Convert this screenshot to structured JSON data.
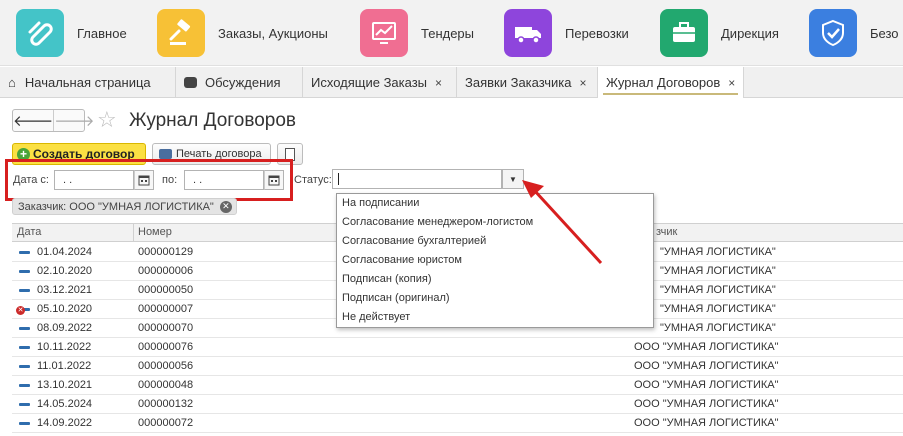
{
  "sections": [
    {
      "label": "Главное",
      "icon": "main-section-icon",
      "color": "#44c4c8"
    },
    {
      "label": "Заказы, Аукционы",
      "icon": "auction-gavel-icon",
      "color": "#f7c136"
    },
    {
      "label": "Тендеры",
      "icon": "chart-icon",
      "color": "#f06e92"
    },
    {
      "label": "Перевозки",
      "icon": "truck-icon",
      "color": "#8e45dc"
    },
    {
      "label": "Дирекция",
      "icon": "briefcase-icon",
      "color": "#22a86f"
    },
    {
      "label": "Безо",
      "icon": "shield-check-icon",
      "color": "#3b7fe0"
    }
  ],
  "tabs": [
    {
      "label": "Начальная страница",
      "icon": "home-icon"
    },
    {
      "label": "Обсуждения",
      "icon": "discussions-icon"
    },
    {
      "label": "Исходящие Заказы",
      "close": "×"
    },
    {
      "label": "Заявки Заказчика",
      "close": "×"
    },
    {
      "label": "Журнал Договоров",
      "close": "×",
      "active": true
    }
  ],
  "form": {
    "title": "Журнал Договоров",
    "back_glyph": "🡐",
    "forward_glyph": "🡒",
    "star_glyph": "☆"
  },
  "toolbar": {
    "create_label": "Создать договор",
    "print_label": "Печать договора"
  },
  "filters": {
    "date_from_label": "Дата с:",
    "date_from_value": " .  .",
    "date_to_label": "по:",
    "date_to_value": " .  .",
    "status_label": "Статус:",
    "status_value": ""
  },
  "chip": {
    "label": "Заказчик: ООО \"УМНАЯ ЛОГИСТИКА\""
  },
  "status_options": [
    "На подписании",
    "Согласование менеджером-логистом",
    "Согласование бухгалтерией",
    "Согласование юристом",
    "Подписан (копия)",
    "Подписан (оригинал)",
    "Не действует"
  ],
  "table": {
    "columns": [
      "Дата",
      "Номер",
      "зчик"
    ],
    "rows": [
      {
        "date": "01.04.2024",
        "number": "000000129",
        "customer": "\"УМНАЯ ЛОГИСТИКА\"",
        "marked": false
      },
      {
        "date": "02.10.2020",
        "number": "000000006",
        "customer": "\"УМНАЯ ЛОГИСТИКА\"",
        "marked": false
      },
      {
        "date": "03.12.2021",
        "number": "000000050",
        "customer": "\"УМНАЯ ЛОГИСТИКА\"",
        "marked": false
      },
      {
        "date": "05.10.2020",
        "number": "000000007",
        "customer": "\"УМНАЯ ЛОГИСТИКА\"",
        "marked": true
      },
      {
        "date": "08.09.2022",
        "number": "000000070",
        "customer": "\"УМНАЯ ЛОГИСТИКА\"",
        "marked": false
      },
      {
        "date": "10.11.2022",
        "number": "000000076",
        "customer": "ООО \"УМНАЯ ЛОГИСТИКА\"",
        "marked": false
      },
      {
        "date": "11.01.2022",
        "number": "000000056",
        "customer": "ООО \"УМНАЯ ЛОГИСТИКА\"",
        "marked": false
      },
      {
        "date": "13.10.2021",
        "number": "000000048",
        "customer": "ООО \"УМНАЯ ЛОГИСТИКА\"",
        "marked": false
      },
      {
        "date": "14.05.2024",
        "number": "000000132",
        "customer": "ООО \"УМНАЯ ЛОГИСТИКА\"",
        "marked": false
      },
      {
        "date": "14.09.2022",
        "number": "000000072",
        "customer": "ООО \"УМНАЯ ЛОГИСТИКА\"",
        "marked": false
      }
    ]
  },
  "colors": {
    "highlight": "#d71f1f",
    "primary_button": "#fbe043"
  }
}
